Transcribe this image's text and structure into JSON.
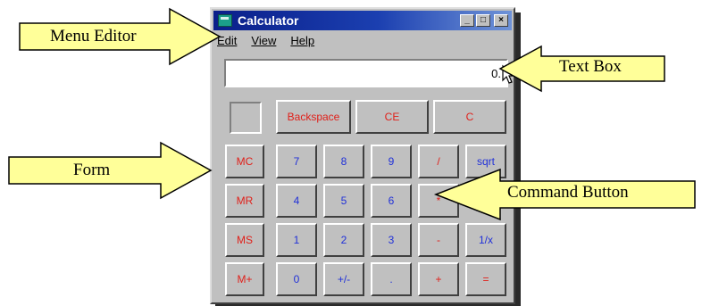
{
  "window": {
    "title": "Calculator",
    "title_buttons": [
      "_",
      "□",
      "×"
    ]
  },
  "menu": [
    {
      "label": "Edit"
    },
    {
      "label": "View"
    },
    {
      "label": "Help"
    }
  ],
  "display": {
    "value": "0."
  },
  "buttons": {
    "backspace": "Backspace",
    "ce": "CE",
    "c": "C",
    "mc": "MC",
    "mr": "MR",
    "ms": "MS",
    "mplus": "M+",
    "n7": "7",
    "n8": "8",
    "n9": "9",
    "div": "/",
    "sqrt": "sqrt",
    "n4": "4",
    "n5": "5",
    "n6": "6",
    "mul": "*",
    "n1": "1",
    "n2": "2",
    "n3": "3",
    "sub": "-",
    "recip": "1/x",
    "n0": "0",
    "sign": "+/-",
    "dot": ".",
    "add": "+",
    "eq": "="
  },
  "callouts": {
    "menu_editor": "Menu Editor",
    "text_box": "Text Box",
    "form": "Form",
    "command_button": "Command Button"
  },
  "colors": {
    "arrow_fill": "#ffff99",
    "title_bar": "#0a1f8a",
    "button_red": "#e0201a",
    "button_blue": "#2030d8"
  }
}
